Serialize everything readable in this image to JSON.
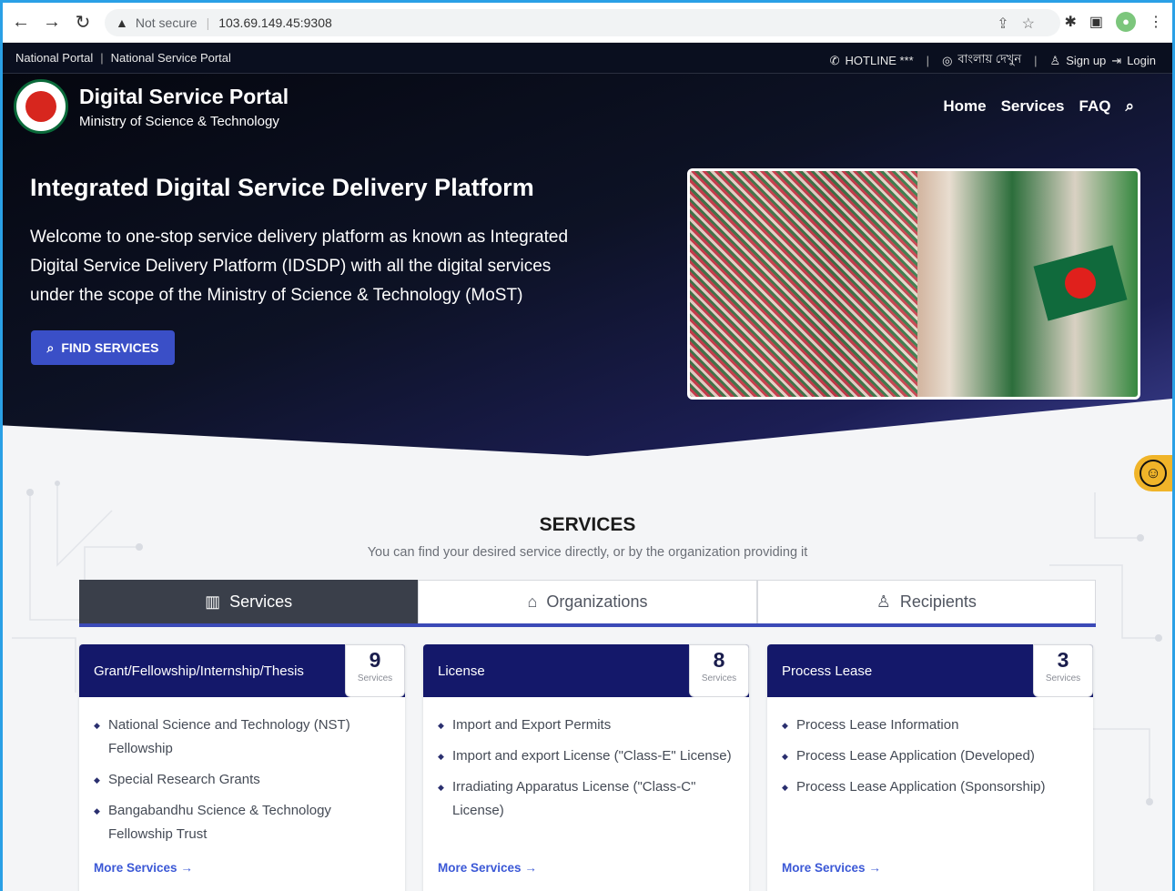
{
  "browser": {
    "security_label": "Not secure",
    "url": "103.69.149.45:9308"
  },
  "topbar": {
    "links": [
      "National Portal",
      "National Service Portal"
    ],
    "hotline": "HOTLINE ***",
    "language": "বাংলায় দেখুন",
    "signup": "Sign up",
    "login": "Login"
  },
  "header": {
    "title": "Digital Service Portal",
    "subtitle": "Ministry of Science & Technology",
    "nav": [
      "Home",
      "Services",
      "FAQ"
    ]
  },
  "hero": {
    "title": "Integrated Digital Service Delivery Platform",
    "text": "Welcome to one-stop service delivery platform as known as Integrated Digital Service Delivery Platform (IDSDP) with all the digital services under the scope of the Ministry of Science & Technology (MoST)",
    "button": "FIND SERVICES"
  },
  "services": {
    "title": "SERVICES",
    "subtitle": "You can find your desired service directly, or by the organization providing it",
    "tabs": [
      "Services",
      "Organizations",
      "Recipients"
    ],
    "count_label": "Services",
    "more_label": "More Services",
    "cards": [
      {
        "title": "Grant/Fellowship/Internship/Thesis",
        "count": "9",
        "items": [
          "National Science and Technology (NST) Fellowship",
          "Special Research Grants",
          "Bangabandhu Science & Technology Fellowship Trust"
        ]
      },
      {
        "title": "License",
        "count": "8",
        "items": [
          "Import and Export Permits",
          "Import and export License (\"Class-E\" License)",
          "Irradiating Apparatus License (\"Class-C\" License)"
        ]
      },
      {
        "title": "Process Lease",
        "count": "3",
        "items": [
          "Process Lease Information",
          "Process Lease Application (Developed)",
          "Process Lease Application (Sponsorship)"
        ]
      }
    ]
  },
  "colors": {
    "hero_dark": "#0a0f1f",
    "accent_blue": "#3a4fc7",
    "card_header": "#14186a",
    "active_tab": "#3a3f4a",
    "link_blue": "#3b58d6"
  }
}
